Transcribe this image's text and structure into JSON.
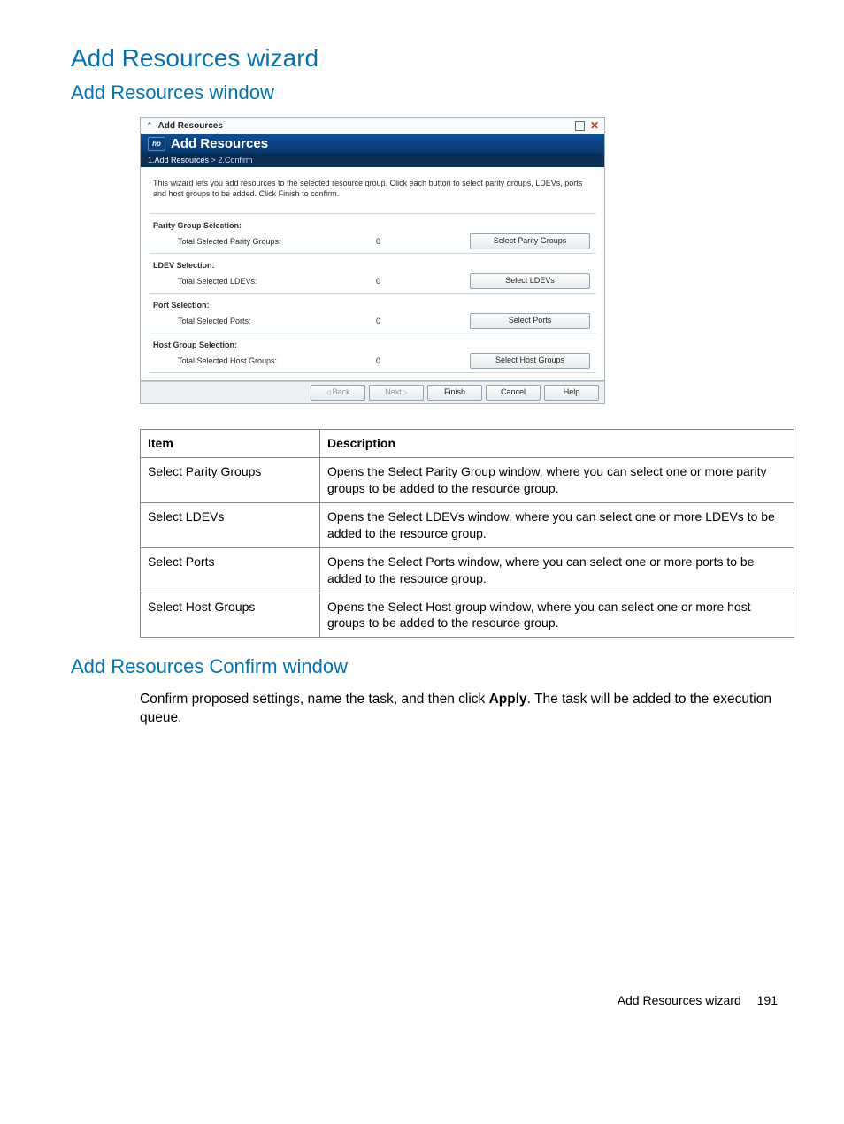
{
  "headings": {
    "h1": "Add Resources wizard",
    "h2a": "Add Resources window",
    "h2b": "Add Resources Confirm window"
  },
  "window": {
    "titlebar": "Add Resources",
    "header": "Add Resources",
    "hp_label": "hp",
    "steps": {
      "active": "1.Add Resources",
      "sep": " > ",
      "next": "2.Confirm"
    },
    "intro": "This wizard lets you add resources to the selected resource group. Click each button to select parity groups, LDEVs, ports and host groups to be added. Click Finish to confirm.",
    "sections": [
      {
        "title": "Parity Group Selection:",
        "label": "Total Selected Parity Groups:",
        "value": "0",
        "button": "Select Parity Groups"
      },
      {
        "title": "LDEV Selection:",
        "label": "Total Selected LDEVs:",
        "value": "0",
        "button": "Select LDEVs"
      },
      {
        "title": "Port Selection:",
        "label": "Total Selected Ports:",
        "value": "0",
        "button": "Select Ports"
      },
      {
        "title": "Host Group Selection:",
        "label": "Total Selected Host Groups:",
        "value": "0",
        "button": "Select Host Groups"
      }
    ],
    "footer": {
      "back": "Back",
      "next": "Next",
      "finish": "Finish",
      "cancel": "Cancel",
      "help": "Help"
    }
  },
  "table": {
    "head": {
      "item": "Item",
      "desc": "Description"
    },
    "rows": [
      {
        "item": "Select Parity Groups",
        "desc": "Opens the Select Parity Group window, where you can select one or more parity groups to be added to the resource group."
      },
      {
        "item": "Select LDEVs",
        "desc": "Opens the Select LDEVs window, where you can select one or more LDEVs to be added to the resource group."
      },
      {
        "item": "Select Ports",
        "desc": "Opens the Select Ports window, where you can select one or more ports to be added to the resource group."
      },
      {
        "item": "Select Host Groups",
        "desc": "Opens the Select Host group window, where you can select one or more host groups to be added to the resource group."
      }
    ]
  },
  "confirm_text": {
    "pre": "Confirm proposed settings, name the task, and then click ",
    "bold": "Apply",
    "post": ". The task will be added to the execution queue."
  },
  "footer": {
    "label": "Add Resources wizard",
    "page": "191"
  }
}
